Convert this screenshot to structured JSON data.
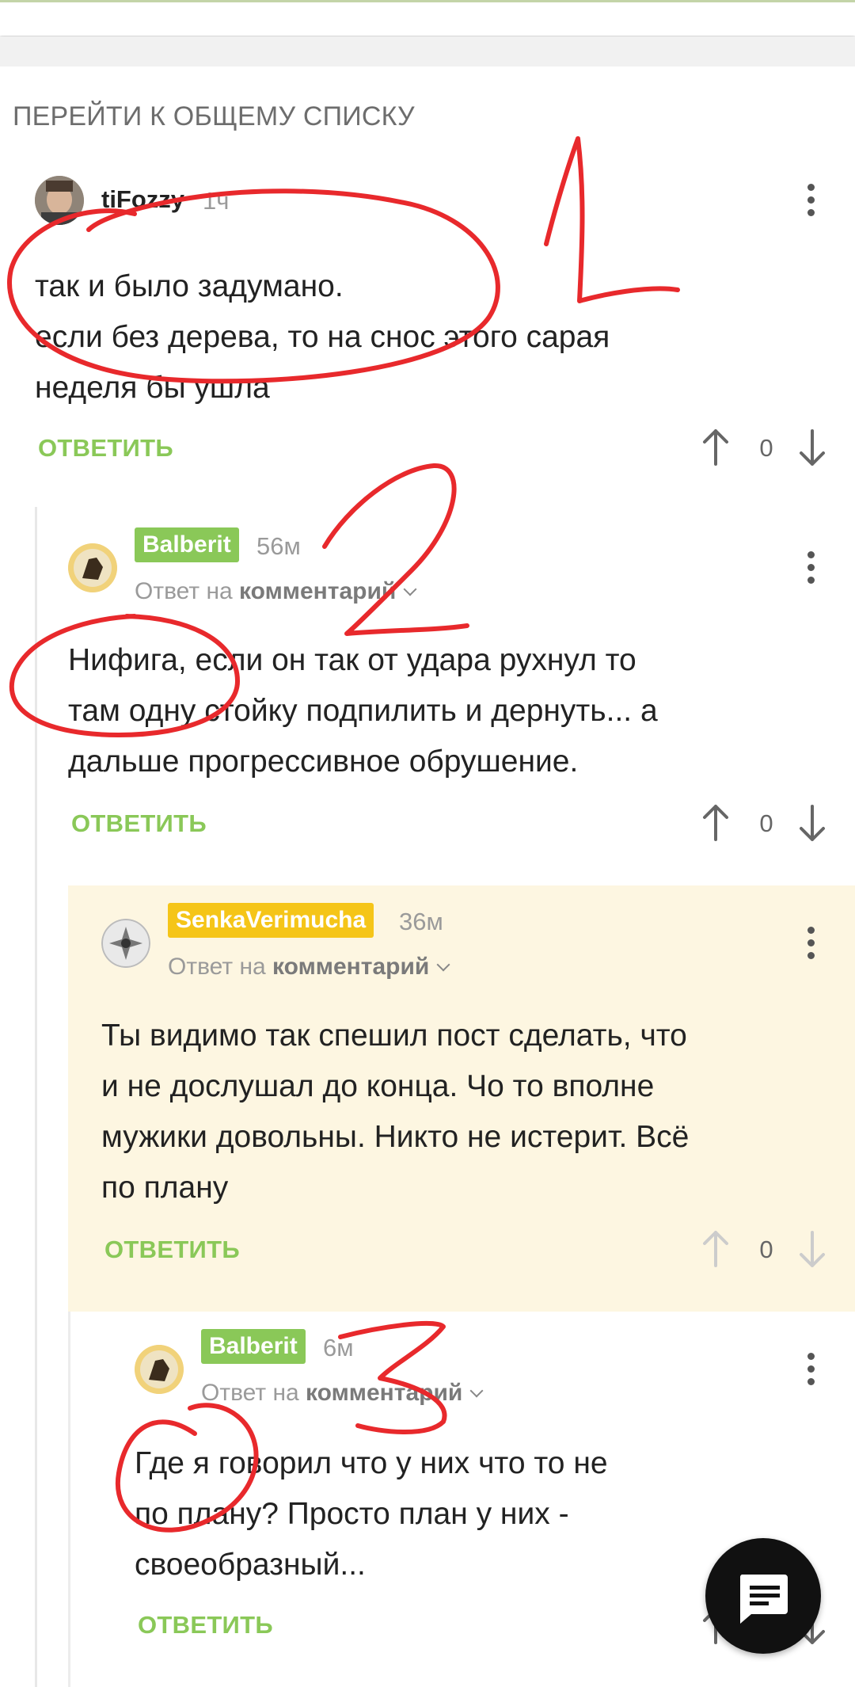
{
  "nav": {
    "goto_list": "ПЕРЕЙТИ К ОБЩЕМУ СПИСКУ"
  },
  "colors": {
    "accent_green": "#8ac858",
    "badge_yellow": "#f5c518",
    "highlight_bg": "#fdf6e1",
    "annotation_red": "#e8292c"
  },
  "comments": [
    {
      "user": "tiFozzy",
      "time": "1ч",
      "reply_prefix": "",
      "reply_target": "",
      "lines": [
        "так и было задумано.",
        "если без дерева, то на снос этого сарая",
        "неделя бы ушла"
      ],
      "answer": "ОТВЕТИТЬ",
      "votes": "0"
    },
    {
      "user": "Balberit",
      "time": "56м",
      "reply_prefix": "Ответ на",
      "reply_target": "комментарий",
      "lines": [
        "Нифига,  если он так  от удара рухнул то",
        "там одну стойку подпилить и дернуть... а",
        "дальше прогрессивное обрушение."
      ],
      "answer": "ОТВЕТИТЬ",
      "votes": "0"
    },
    {
      "user": "SenkaVerimucha",
      "time": "36м",
      "reply_prefix": "Ответ на",
      "reply_target": "комментарий",
      "lines": [
        "Ты видимо так спешил пост сделать, что",
        "и не дослушал до конца. Чо то вполне",
        "мужики довольны. Никто не истерит. Всё",
        "по плану"
      ],
      "answer": "ОТВЕТИТЬ",
      "votes": "0"
    },
    {
      "user": "Balberit",
      "time": "6м",
      "reply_prefix": "Ответ на",
      "reply_target": "комментарий",
      "lines": [
        "Где я говорил что у них что то не",
        "по плану? Просто план у них -",
        "своеобразный..."
      ],
      "answer": "ОТВЕТИТЬ",
      "votes": ""
    }
  ],
  "annotations": {
    "n1": "1",
    "n2": "2",
    "n3": "3"
  },
  "icons": {
    "more": "more-vert-icon",
    "up": "arrow-up-icon",
    "down": "arrow-down-icon",
    "fab": "chat-compose-icon"
  }
}
